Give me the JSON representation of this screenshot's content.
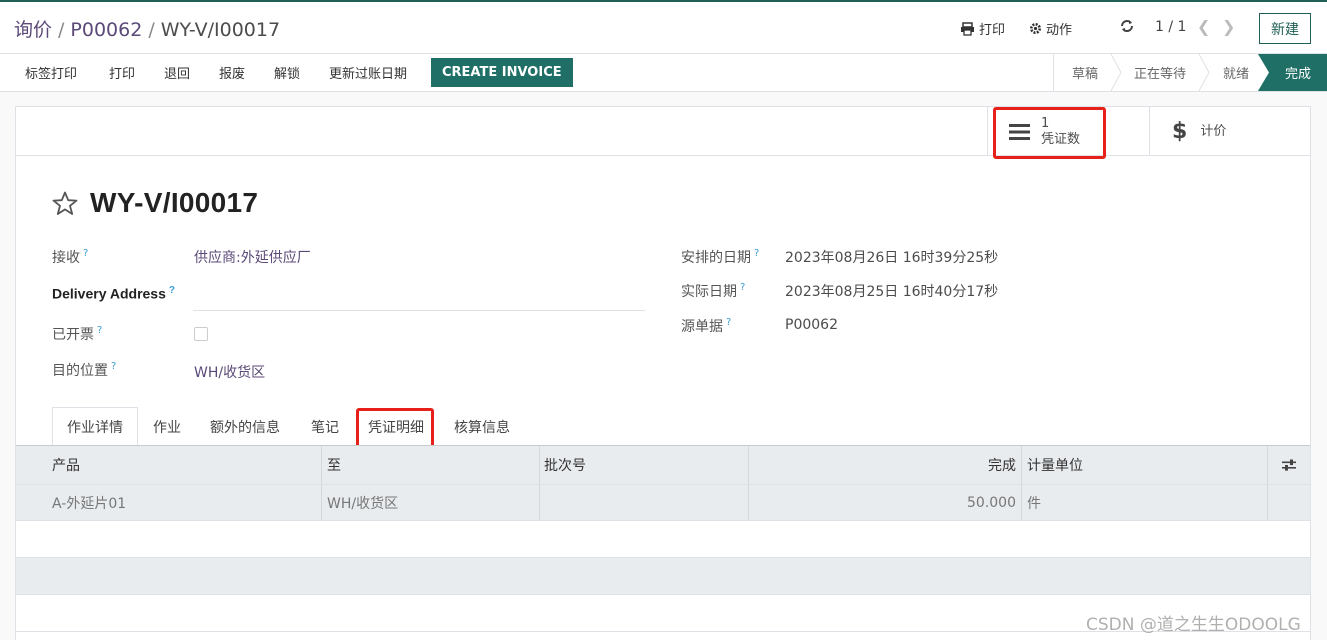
{
  "breadcrumb": {
    "level1": "询价",
    "level2": "P00062",
    "current": "WY-V/I00017",
    "separator": "/"
  },
  "control_panel": {
    "print_label": "打印",
    "action_label": "动作",
    "pager": "1 / 1",
    "new_label": "新建"
  },
  "status_bar": {
    "buttons": [
      "标签打印",
      "打印",
      "退回",
      "报废",
      "解锁",
      "更新过账日期"
    ],
    "primary_button": "CREATE INVOICE",
    "stages": [
      "草稿",
      "正在等待",
      "就绪",
      "完成"
    ],
    "active_stage": "完成"
  },
  "smart_buttons": {
    "voucher_count": "1",
    "voucher_label": "凭证数",
    "pricing_label": "计价"
  },
  "record": {
    "title": "WY-V/I00017",
    "left_fields": {
      "receive_label": "接收",
      "receive_value": "供应商:外延供应厂",
      "delivery_address_label": "Delivery Address",
      "delivery_address_value": "",
      "invoiced_label": "已开票",
      "destination_label": "目的位置",
      "destination_value": "WH/收货区"
    },
    "right_fields": {
      "scheduled_label": "安排的日期",
      "scheduled_value": "2023年08月26日 16时39分25秒",
      "actual_label": "实际日期",
      "actual_value": "2023年08月25日 16时40分17秒",
      "source_label": "源单据",
      "source_value": "P00062"
    },
    "help_marker": "?"
  },
  "tabs": [
    "作业详情",
    "作业",
    "额外的信息",
    "笔记",
    "凭证明细",
    "核算信息"
  ],
  "table": {
    "headers": [
      "产品",
      "至",
      "批次号",
      "完成",
      "计量单位"
    ],
    "rows": [
      {
        "product": "A-外延片01",
        "to": "WH/收货区",
        "lot": "",
        "done": "50.000",
        "uom": "件"
      }
    ]
  },
  "watermark": "CSDN @道之生生ODOOLG",
  "colors": {
    "brand": "#1f6f66",
    "highlight": "#e8201a",
    "link": "#5b4a78"
  }
}
